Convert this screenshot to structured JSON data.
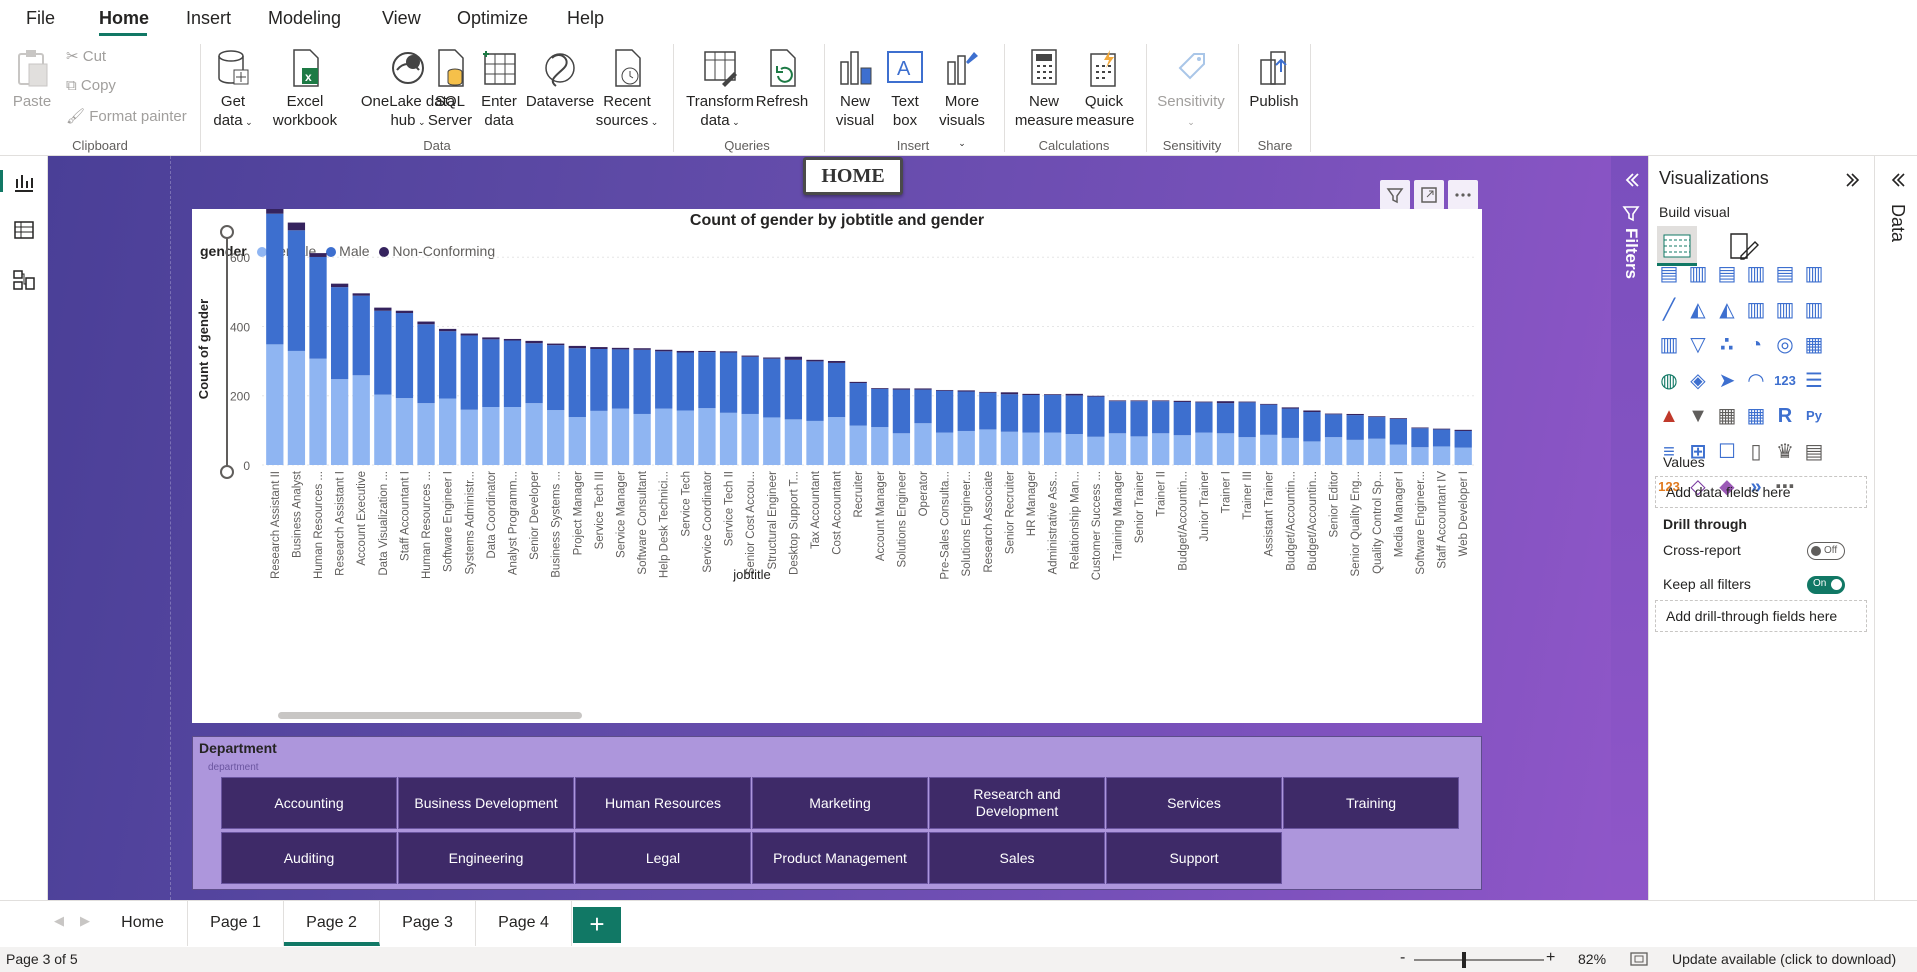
{
  "menu": [
    "File",
    "Home",
    "Insert",
    "Modeling",
    "View",
    "Optimize",
    "Help"
  ],
  "ribbon": {
    "clipboard": {
      "paste": "Paste",
      "cut": "Cut",
      "copy": "Copy",
      "format_painter": "Format painter",
      "group": "Clipboard"
    },
    "data": {
      "get_data": [
        "Get",
        "data"
      ],
      "excel": [
        "Excel",
        "workbook"
      ],
      "onelake": [
        "OneLake data",
        "hub"
      ],
      "sql": [
        "SQL",
        "Server"
      ],
      "enter": [
        "Enter",
        "data"
      ],
      "dataverse": "Dataverse",
      "recent": [
        "Recent",
        "sources"
      ],
      "group": "Data"
    },
    "queries": {
      "transform": [
        "Transform",
        "data"
      ],
      "refresh": "Refresh",
      "group": "Queries"
    },
    "insert": {
      "new_visual": [
        "New",
        "visual"
      ],
      "text_box": [
        "Text",
        "box"
      ],
      "more_visuals": [
        "More",
        "visuals"
      ],
      "group": "Insert"
    },
    "calculations": {
      "new_measure": [
        "New",
        "measure"
      ],
      "quick_measure": [
        "Quick",
        "measure"
      ],
      "group": "Calculations"
    },
    "sensitivity": {
      "label": "Sensitivity",
      "group": "Sensitivity"
    },
    "share": {
      "publish": "Publish",
      "group": "Share"
    }
  },
  "home_button": "HOME",
  "chart_data": {
    "type": "bar",
    "stacked": true,
    "title": "Count of gender by jobtitle and gender",
    "legend_title": "gender",
    "xlabel": "jobtitle",
    "ylabel": "Count of gender",
    "ylim": [
      0,
      670
    ],
    "yticks": [
      0,
      200,
      400,
      600
    ],
    "colors": {
      "Female": "#8fb5f2",
      "Male": "#3d6fcf",
      "Non-Conforming": "#35235e"
    },
    "categories": [
      "Research Assistant II",
      "Business Analyst",
      "Human Resources ...",
      "Research Assistant I",
      "Account Executive",
      "Data Visualization ...",
      "Staff Accountant I",
      "Human Resources ...",
      "Software Engineer I",
      "Systems Administr...",
      "Data Coordinator",
      "Analyst Programm...",
      "Senior Developer",
      "Business Systems ...",
      "Project Manager",
      "Service Tech III",
      "Service Manager",
      "Software Consultant",
      "Help Desk Technici...",
      "Service Tech",
      "Service Coordinator",
      "Service Tech II",
      "Senior Cost Accou...",
      "Structural Engineer",
      "Desktop Support T...",
      "Tax Accountant",
      "Cost Accountant",
      "Recruiter",
      "Account Manager",
      "Solutions Engineer",
      "Operator",
      "Pre-Sales Consulta...",
      "Solutions Engineer...",
      "Research Associate",
      "Senior Recruiter",
      "HR Manager",
      "Administrative Ass...",
      "Relationship Man...",
      "Customer Success ...",
      "Training Manager",
      "Senior Trainer",
      "Trainer II",
      "Budget/Accountin...",
      "Junior Trainer",
      "Trainer I",
      "Trainer III",
      "Assistant Trainer",
      "Budget/Accountin...",
      "Budget/Accountin...",
      "Senior Editor",
      "Senior Quality Eng...",
      "Quality Control Sp...",
      "Media Manager I",
      "Software Engineer...",
      "Staff Accountant IV",
      "Web Developer I"
    ],
    "series": [
      {
        "name": "Female",
        "values": [
          312,
          295,
          275,
          222,
          232,
          182,
          173,
          160,
          172,
          143,
          150,
          150,
          160,
          142,
          124,
          140,
          146,
          132,
          146,
          141,
          147,
          135,
          132,
          123,
          118,
          114,
          124,
          102,
          98,
          82,
          108,
          84,
          88,
          92,
          86,
          84,
          84,
          80,
          73,
          82,
          74,
          82,
          77,
          84,
          82,
          72,
          78,
          70,
          61,
          72,
          65,
          68,
          53,
          46,
          48,
          45
        ]
      },
      {
        "name": "Male",
        "values": [
          338,
          312,
          263,
          238,
          206,
          217,
          220,
          204,
          174,
          192,
          175,
          172,
          155,
          168,
          178,
          160,
          153,
          166,
          148,
          150,
          145,
          156,
          148,
          152,
          154,
          154,
          140,
          110,
          99,
          113,
          87,
          108,
          102,
          95,
          97,
          97,
          97,
          100,
          104,
          83,
          91,
          83,
          86,
          78,
          78,
          90,
          78,
          76,
          76,
          59,
          64,
          56,
          66,
          49,
          44,
          43
        ]
      },
      {
        "name": "Non-Conforming",
        "values": [
          14,
          20,
          10,
          9,
          6,
          8,
          6,
          7,
          6,
          5,
          5,
          4,
          6,
          4,
          6,
          5,
          4,
          4,
          4,
          4,
          3,
          3,
          3,
          3,
          8,
          4,
          5,
          3,
          2,
          3,
          3,
          2,
          3,
          2,
          5,
          3,
          2,
          4,
          2,
          2,
          2,
          2,
          3,
          2,
          5,
          2,
          2,
          3,
          4,
          2,
          3,
          2,
          2,
          2,
          2,
          3
        ]
      }
    ]
  },
  "slicer": {
    "title": "Department",
    "field": "department",
    "items": [
      "Accounting",
      "Business Development",
      "Human Resources",
      "Marketing",
      "Research and Development",
      "Services",
      "Training",
      "Auditing",
      "Engineering",
      "Legal",
      "Product Management",
      "Sales",
      "Support"
    ]
  },
  "filters_label": "Filters",
  "viz": {
    "title": "Visualizations",
    "build": "Build visual",
    "values": "Values",
    "add_data": "Add data fields here",
    "drill": "Drill through",
    "cross_report": "Cross-report",
    "cross_state": "Off",
    "keep_filters": "Keep all filters",
    "keep_state": "On",
    "add_drill": "Add drill-through fields here"
  },
  "data_label": "Data",
  "tabs": [
    "Home",
    "Page 1",
    "Page 2",
    "Page 3",
    "Page 4"
  ],
  "active_tab": "Page 2",
  "status": {
    "page": "Page 3 of 5",
    "zoom": "82%",
    "update": "Update available (click to download)"
  }
}
